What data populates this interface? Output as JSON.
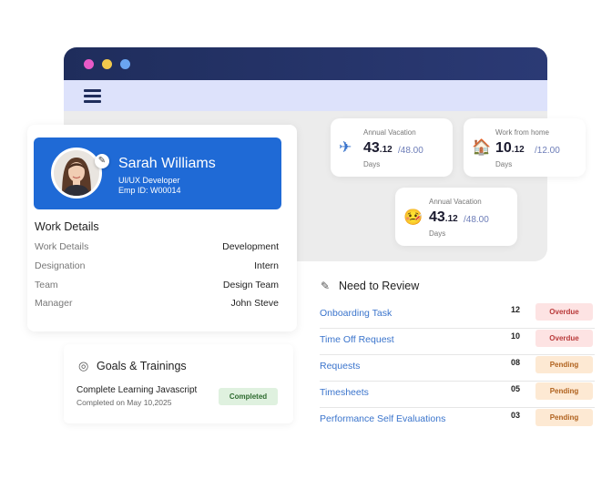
{
  "profile": {
    "name": "Sarah Williams",
    "role": "UI/UX Developer",
    "emp_id": "Emp ID: W00014"
  },
  "work_details": {
    "title": "Work Details",
    "rows": [
      {
        "label": "Work Details",
        "value": "Development"
      },
      {
        "label": "Designation",
        "value": "Intern"
      },
      {
        "label": "Team",
        "value": "Design Team"
      },
      {
        "label": "Manager",
        "value": "John Steve"
      }
    ]
  },
  "stats": [
    {
      "label": "Annual Vacation",
      "big": "43",
      "decimal": ".12",
      "of": "/48.00",
      "unit": "Days",
      "icon": "airplane-icon"
    },
    {
      "label": "Work from home",
      "big": "10",
      "decimal": ".12",
      "of": "/12.00",
      "unit": "Days",
      "icon": "house-icon"
    },
    {
      "label": "Annual Vacation",
      "big": "43",
      "decimal": ".12",
      "of": "/48.00",
      "unit": "Days",
      "icon": "sick-face-icon"
    }
  ],
  "review": {
    "title": "Need to Review",
    "items": [
      {
        "name": "Onboarding Task",
        "count": "12",
        "status": "Overdue"
      },
      {
        "name": "Time Off Request",
        "count": "10",
        "status": "Overdue"
      },
      {
        "name": "Requests",
        "count": "08",
        "status": "Pending"
      },
      {
        "name": "Timesheets",
        "count": "05",
        "status": "Pending"
      },
      {
        "name": "Performance Self Evaluations",
        "count": "03",
        "status": "Pending"
      }
    ]
  },
  "goals": {
    "title": "Goals & Trainings",
    "course": "Complete Learning Javascript",
    "date": "Completed on May 10,2025",
    "status": "Completed"
  },
  "colors": {
    "titlebar": "#1f2d5c",
    "menubar": "#dde2fb",
    "profile_banner": "#1f6ad6",
    "link": "#3a74cc",
    "overdue_bg": "#fde3e3",
    "pending_bg": "#fde9d3",
    "completed_bg": "#dff1df"
  }
}
